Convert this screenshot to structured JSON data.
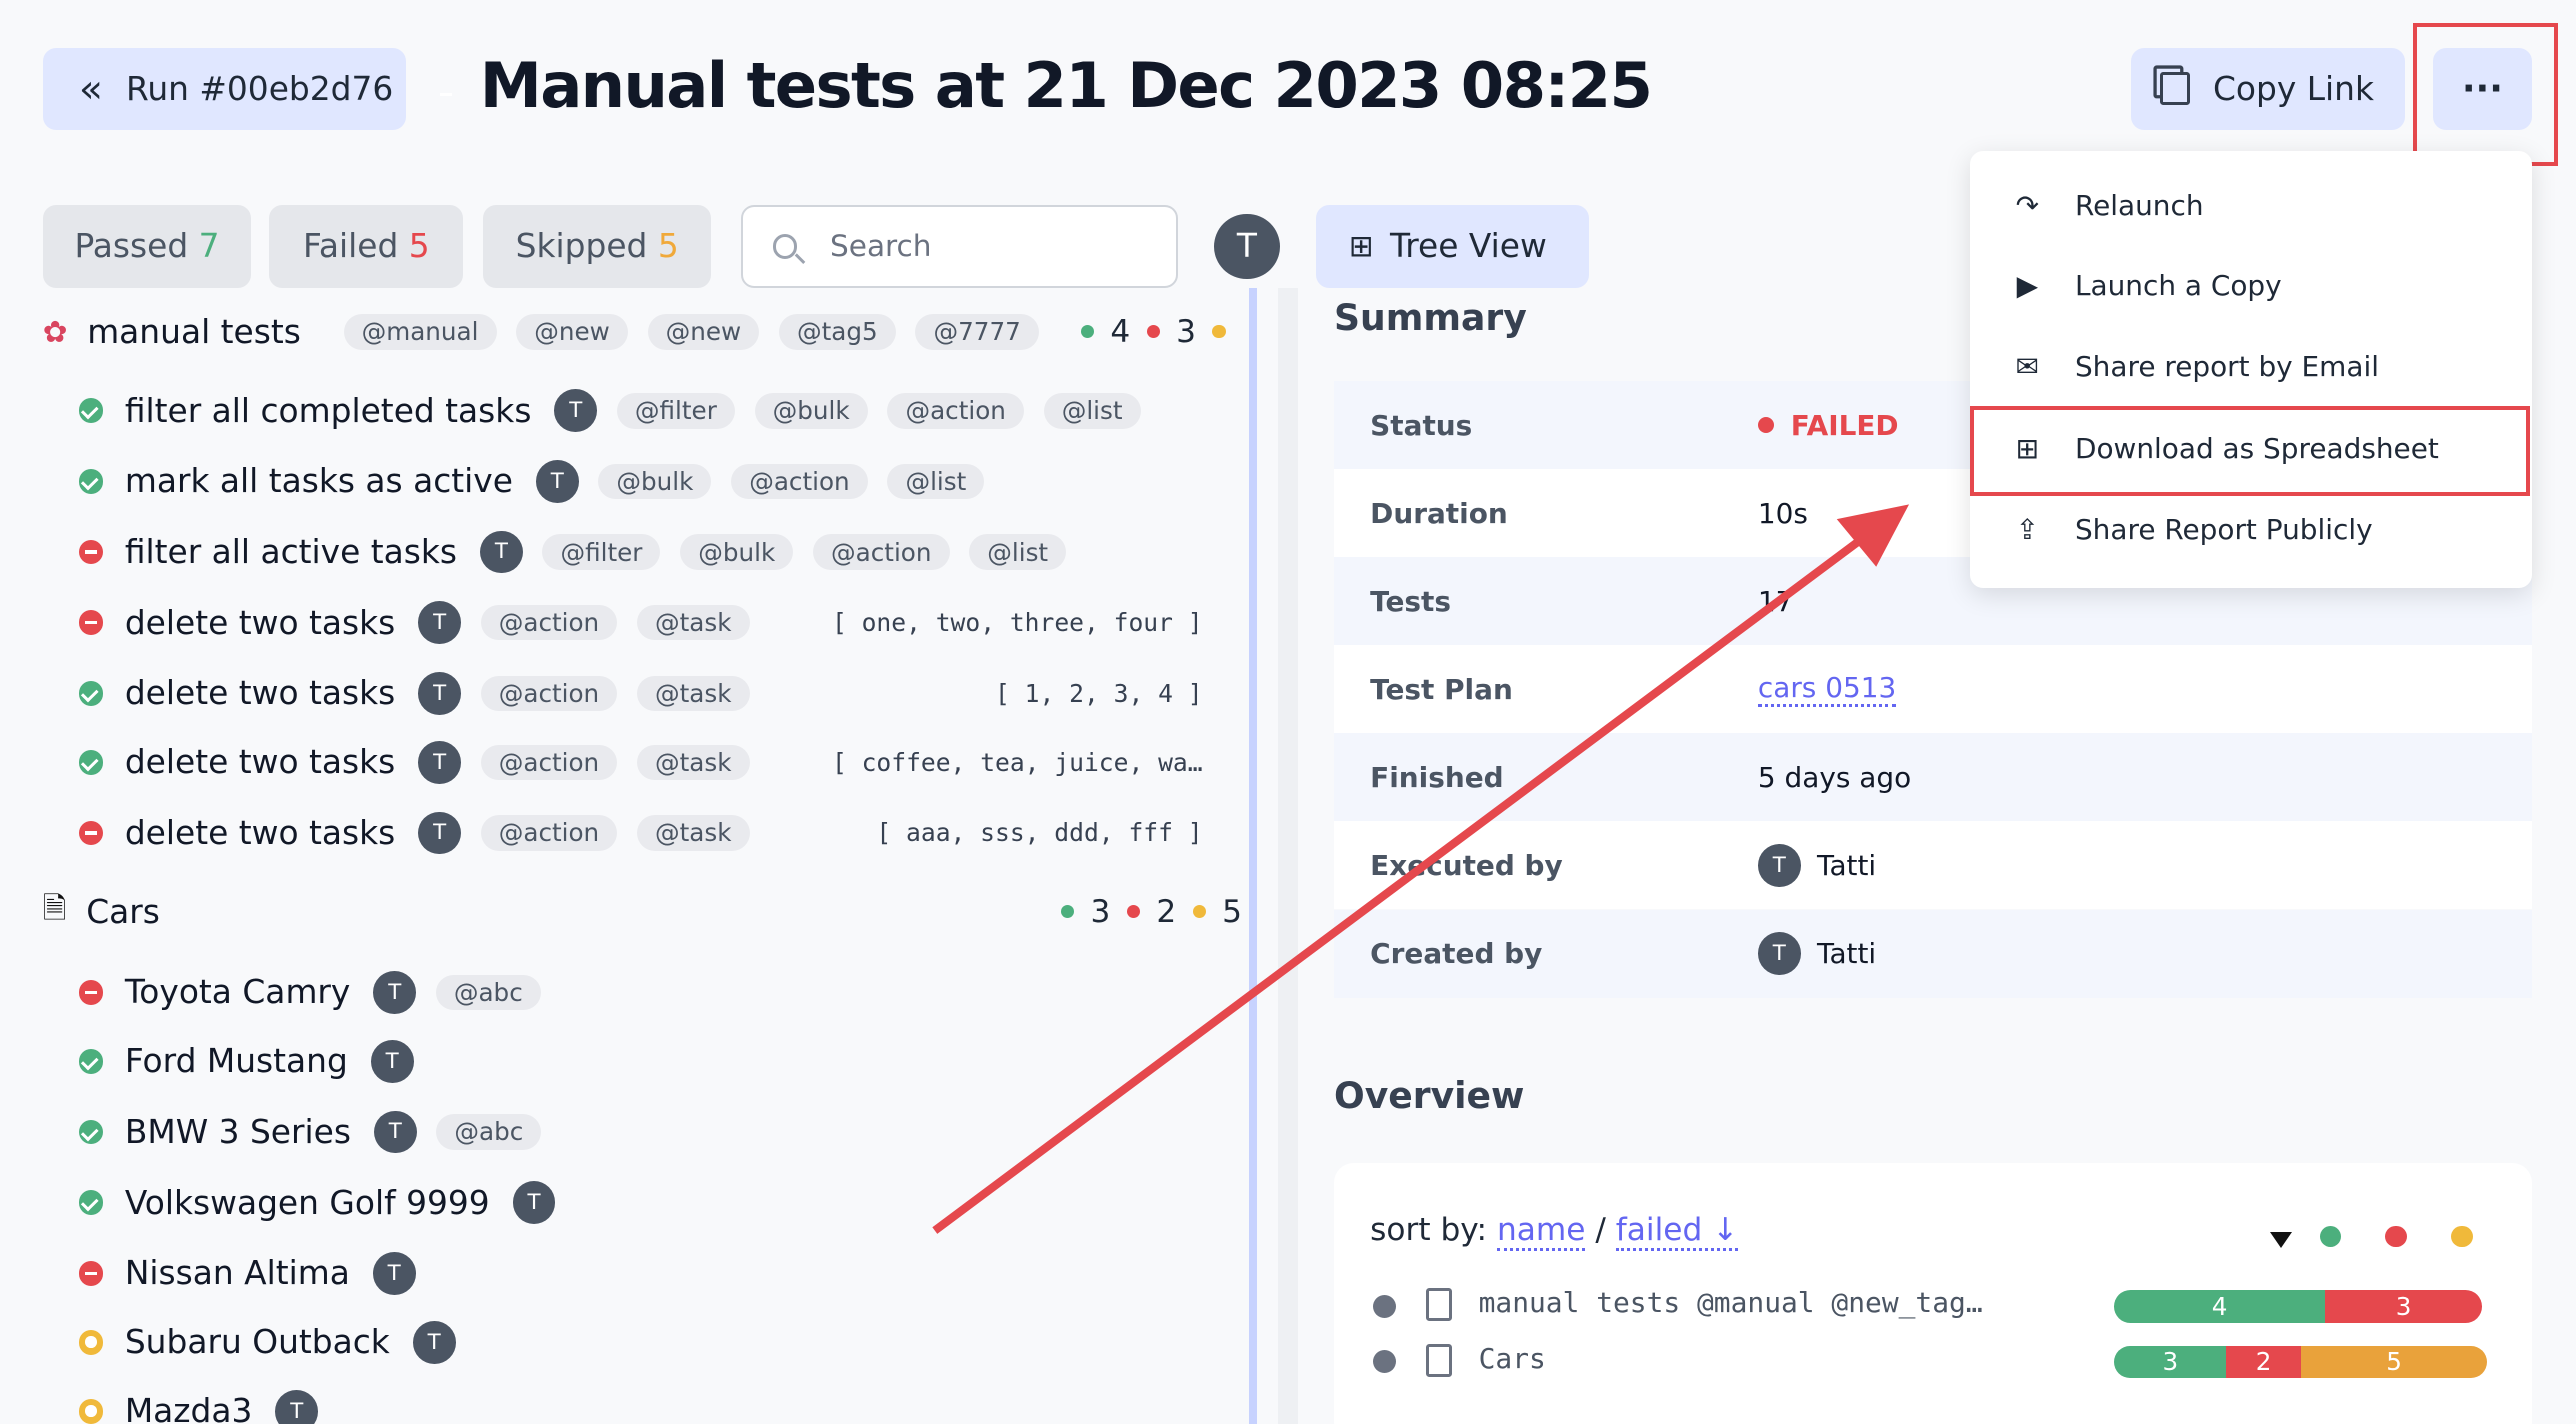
{
  "header": {
    "run_label": "Run #00eb2d76",
    "title": "Manual tests at 21 Dec 2023 08:25",
    "copy_link": "Copy Link",
    "more": "···"
  },
  "filters": {
    "passed_label": "Passed",
    "passed_count": "7",
    "failed_label": "Failed",
    "failed_count": "5",
    "skipped_label": "Skipped",
    "skipped_count": "5",
    "search_placeholder": "Search",
    "avatar": "T"
  },
  "tree_view": "Tree View",
  "suites": [
    {
      "name": "manual tests",
      "tags": [
        "@manual",
        "@new",
        "@new",
        "@tag5",
        "@7777"
      ],
      "passed": "4",
      "failed": "3",
      "tests": [
        {
          "status": "pass",
          "name": "filter all completed tasks",
          "tags": [
            "@filter",
            "@bulk",
            "@action",
            "@list"
          ],
          "args": ""
        },
        {
          "status": "pass",
          "name": "mark all tasks as active",
          "tags": [
            "@bulk",
            "@action",
            "@list"
          ],
          "args": ""
        },
        {
          "status": "fail",
          "name": "filter all active tasks",
          "tags": [
            "@filter",
            "@bulk",
            "@action",
            "@list"
          ],
          "args": ""
        },
        {
          "status": "fail",
          "name": "delete two tasks",
          "tags": [
            "@action",
            "@task"
          ],
          "args": "[ one, two, three, four ]"
        },
        {
          "status": "pass",
          "name": "delete two tasks",
          "tags": [
            "@action",
            "@task"
          ],
          "args": "[ 1, 2, 3, 4 ]"
        },
        {
          "status": "pass",
          "name": "delete two tasks",
          "tags": [
            "@action",
            "@task"
          ],
          "args": "[ coffee, tea, juice, wa…"
        },
        {
          "status": "fail",
          "name": "delete two tasks",
          "tags": [
            "@action",
            "@task"
          ],
          "args": "[ aaa, sss, ddd, fff ]"
        }
      ]
    },
    {
      "name": "Cars",
      "tags": [],
      "passed": "3",
      "failed": "2",
      "skipped": "5",
      "tests": [
        {
          "status": "fail",
          "name": "Toyota Camry",
          "tags": [
            "@abc"
          ]
        },
        {
          "status": "pass",
          "name": "Ford Mustang",
          "tags": []
        },
        {
          "status": "pass",
          "name": "BMW 3 Series",
          "tags": [
            "@abc"
          ]
        },
        {
          "status": "pass",
          "name": "Volkswagen Golf 9999",
          "tags": []
        },
        {
          "status": "fail",
          "name": "Nissan Altima",
          "tags": []
        },
        {
          "status": "skip",
          "name": "Subaru Outback",
          "tags": []
        },
        {
          "status": "skip",
          "name": "Mazda3",
          "tags": []
        }
      ]
    }
  ],
  "summary": {
    "heading": "Summary",
    "rows": [
      {
        "k": "Status",
        "v": "FAILED"
      },
      {
        "k": "Duration",
        "v": "10s"
      },
      {
        "k": "Tests",
        "v": "17"
      },
      {
        "k": "Test Plan",
        "v": "cars 0513"
      },
      {
        "k": "Finished",
        "v": "5 days ago"
      },
      {
        "k": "Executed by",
        "v": "Tatti"
      },
      {
        "k": "Created by",
        "v": "Tatti"
      }
    ]
  },
  "overview": {
    "heading": "Overview",
    "sort_by": "sort by:",
    "sort_name": "name",
    "sep": "/",
    "sort_failed": "failed",
    "arrow": "↓",
    "rows": [
      {
        "name": "manual tests @manual @new_tag…",
        "passed": 4,
        "failed": 3,
        "skipped": 0
      },
      {
        "name": "Cars",
        "passed": 3,
        "failed": 2,
        "skipped": 5
      }
    ]
  },
  "menu": {
    "items": [
      "Relaunch",
      "Launch a Copy",
      "Share report by Email",
      "Download as Spreadsheet",
      "Share Report Publicly"
    ]
  },
  "colors": {
    "passed": "#4caf7d",
    "failed": "#e5484d",
    "skipped": "#f0b93a",
    "accent": "#6366f1",
    "highlight": "#e5484d"
  }
}
